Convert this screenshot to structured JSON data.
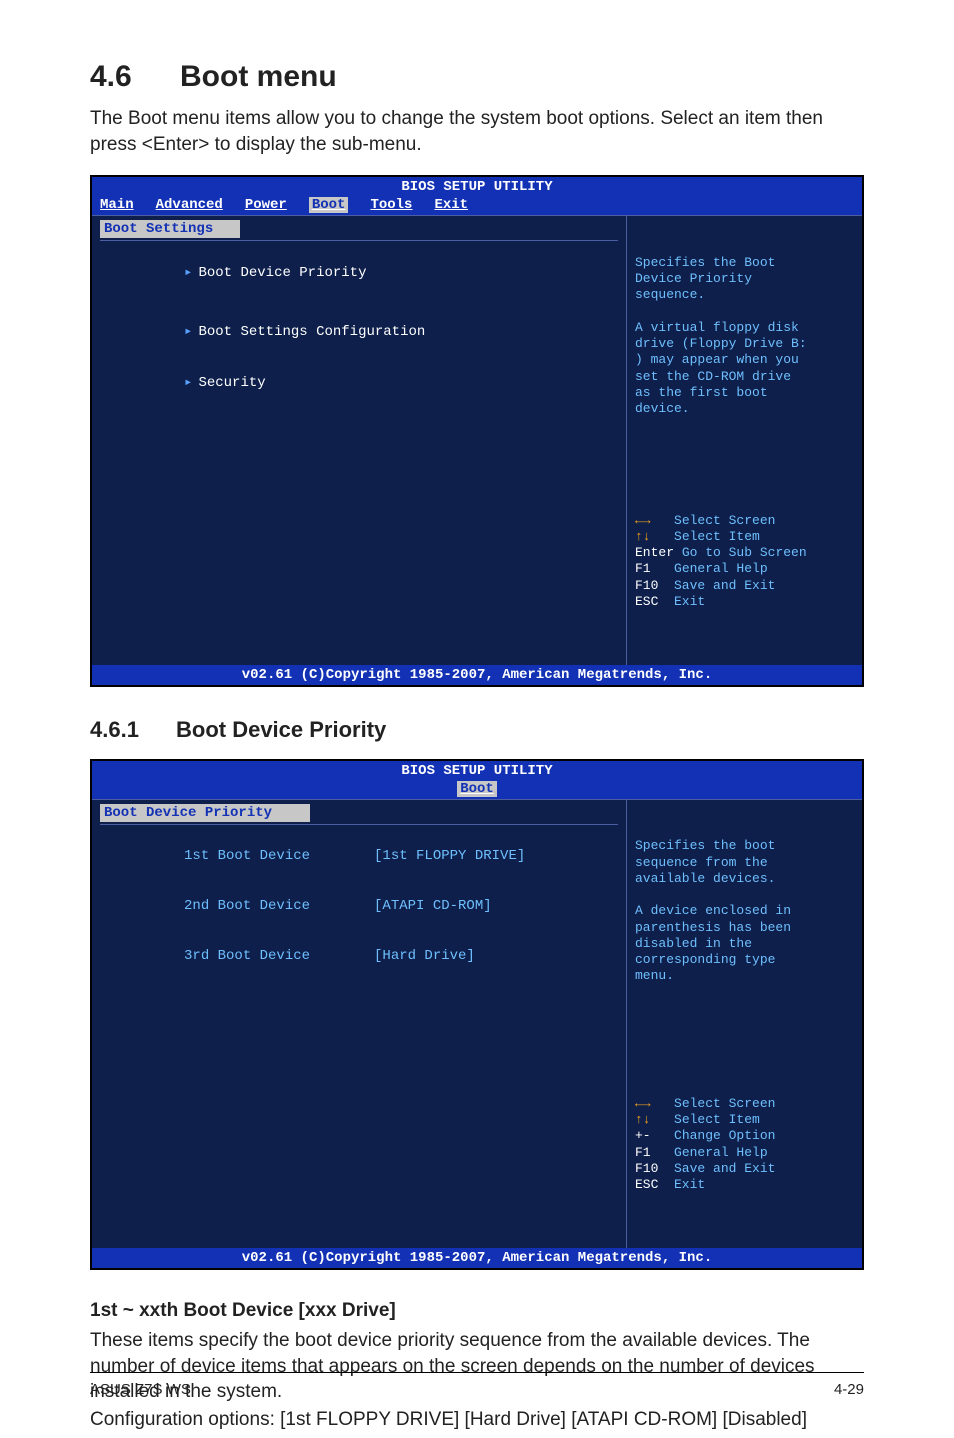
{
  "heading": {
    "num": "4.6",
    "title": "Boot menu"
  },
  "intro": "The Boot menu items allow you to change the system boot options. Select an item then press <Enter> to display the sub-menu.",
  "bios1": {
    "title": "BIOS SETUP UTILITY",
    "tabs": [
      "Main",
      "Advanced",
      "Power",
      "Boot",
      "Tools",
      "Exit"
    ],
    "activeTab": "Boot",
    "leftHeader": "Boot Settings",
    "items": [
      {
        "arrow": "▸",
        "label": "Boot Device Priority"
      },
      {
        "arrow": "▸",
        "label": "Boot Settings Configuration"
      },
      {
        "arrow": "▸",
        "label": "Security"
      }
    ],
    "helpTop": "Specifies the Boot\nDevice Priority\nsequence.\n\nA virtual floppy disk\ndrive (Floppy Drive B:\n) may appear when you\nset the CD-ROM drive\nas the first boot\ndevice.",
    "keys": [
      {
        "k": "←→",
        "d": "   Select Screen"
      },
      {
        "k": "↑↓",
        "d": "   Select Item"
      },
      {
        "k": "Enter",
        "d": "Go to Sub Screen"
      },
      {
        "k": "F1",
        "d": "   General Help"
      },
      {
        "k": "F10",
        "d": "  Save and Exit"
      },
      {
        "k": "ESC",
        "d": "  Exit"
      }
    ],
    "footer": "v02.61 (C)Copyright 1985-2007, American Megatrends, Inc."
  },
  "sub": {
    "num": "4.6.1",
    "title": "Boot Device Priority"
  },
  "bios2": {
    "title": "BIOS SETUP UTILITY",
    "activeTab": "Boot",
    "leftHeader": "Boot Device Priority",
    "rows": [
      {
        "c1": "1st Boot Device",
        "c2": "[1st FLOPPY DRIVE]"
      },
      {
        "c1": "2nd Boot Device",
        "c2": "[ATAPI CD-ROM]"
      },
      {
        "c1": "3rd Boot Device",
        "c2": "[Hard Drive]"
      }
    ],
    "helpTop": "Specifies the boot\nsequence from the\navailable devices.\n\nA device enclosed in\nparenthesis has been\ndisabled in the\ncorresponding type\nmenu.",
    "keys": [
      {
        "k": "←→",
        "d": "   Select Screen"
      },
      {
        "k": "↑↓",
        "d": "   Select Item"
      },
      {
        "k": "+-",
        "d": "   Change Option"
      },
      {
        "k": "F1",
        "d": "   General Help"
      },
      {
        "k": "F10",
        "d": "  Save and Exit"
      },
      {
        "k": "ESC",
        "d": "  Exit"
      }
    ],
    "footer": "v02.61 (C)Copyright 1985-2007, American Megatrends, Inc."
  },
  "h3": "1st ~ xxth Boot Device [xxx Drive]",
  "body1": "These items specify the boot device priority sequence from the available devices. The number of device items that appears on the screen depends on the number of devices installed in the system.",
  "body2": "Configuration options: [1st FLOPPY DRIVE] [Hard Drive] [ATAPI CD-ROM] [Disabled]",
  "footer": {
    "left": "ASUS Z7S WS",
    "right": "4-29"
  }
}
